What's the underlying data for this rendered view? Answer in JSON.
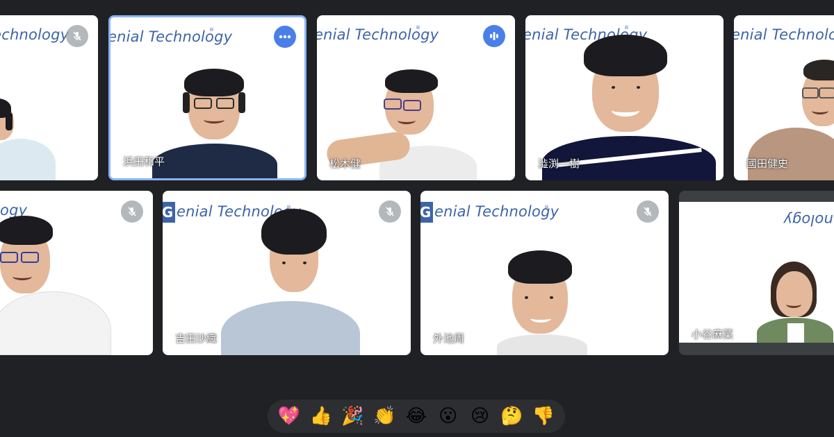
{
  "brand_text": "enial Technology",
  "brand_mark": "G",
  "participants": [
    {
      "name": "",
      "status": "muted"
    },
    {
      "name": "浜田和平",
      "status": "more-options"
    },
    {
      "name": "松木健",
      "status": "speaking"
    },
    {
      "name": "澁渕一樹",
      "status": "none"
    },
    {
      "name": "國田健史",
      "status": "none"
    },
    {
      "name": "",
      "status": "muted"
    },
    {
      "name": "吉田沙織",
      "status": "muted"
    },
    {
      "name": "外池周",
      "status": "muted"
    },
    {
      "name": "小谷麻菜",
      "status": "none"
    }
  ],
  "reactions": [
    "💖",
    "👍",
    "🎉",
    "👏",
    "😂",
    "😮",
    "😢",
    "🤔",
    "👎"
  ],
  "colors": {
    "background": "#202124",
    "active_border": "#8ab4f8",
    "brand": "#3d64a8",
    "speaking": "#4a7fea"
  }
}
